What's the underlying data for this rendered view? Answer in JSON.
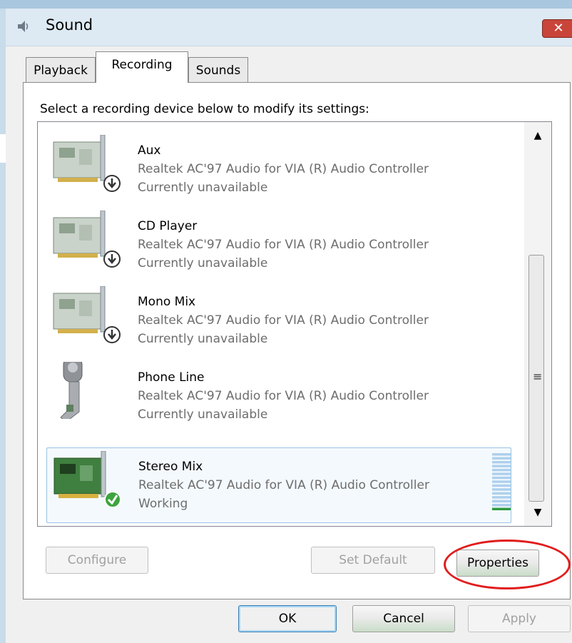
{
  "window": {
    "title": "Sound",
    "close_label": "✕"
  },
  "tabs": [
    {
      "label": "Playback",
      "active": false
    },
    {
      "label": "Recording",
      "active": true
    },
    {
      "label": "Sounds",
      "active": false
    }
  ],
  "instruction": "Select a recording device below to modify its settings:",
  "devices": [
    {
      "name": "Aux",
      "description": "Realtek AC'97 Audio for VIA (R) Audio Controller",
      "status": "Currently unavailable",
      "icon": "sound-card-icon",
      "badge": "down-arrow-badge-icon"
    },
    {
      "name": "CD Player",
      "description": "Realtek AC'97 Audio for VIA (R) Audio Controller",
      "status": "Currently unavailable",
      "icon": "sound-card-icon",
      "badge": "down-arrow-badge-icon"
    },
    {
      "name": "Mono Mix",
      "description": "Realtek AC'97 Audio for VIA (R) Audio Controller",
      "status": "Currently unavailable",
      "icon": "sound-card-icon",
      "badge": "down-arrow-badge-icon"
    },
    {
      "name": "Phone Line",
      "description": "Realtek AC'97 Audio for VIA (R) Audio Controller",
      "status": "Currently unavailable",
      "icon": "phone-handset-icon"
    },
    {
      "name": "Stereo Mix",
      "description": "Realtek AC'97 Audio for VIA (R) Audio Controller",
      "status": "Working",
      "icon": "sound-card-icon",
      "badge": "green-check-badge-icon",
      "selected": true,
      "level_bars_total": 15,
      "level_bars_lit": 1
    }
  ],
  "scrollbar": {
    "up": "▲",
    "down": "▼",
    "grip": "≡"
  },
  "buttons": {
    "configure": "Configure",
    "set_default": "Set Default",
    "properties": "Properties",
    "ok": "OK",
    "cancel": "Cancel",
    "apply": "Apply"
  },
  "colors": {
    "highlight_circle": "#e11d1d",
    "selected_row_border": "#99c4e4",
    "meter_bar": "#aed0ec",
    "meter_active": "#2e9a3c",
    "close_button": "#c9453a"
  }
}
